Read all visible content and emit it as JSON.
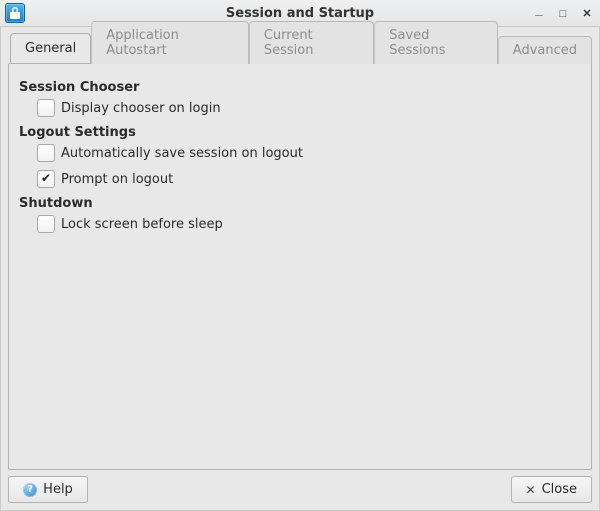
{
  "window": {
    "title": "Session and Startup"
  },
  "tabs": {
    "general": "General",
    "autostart": "Application Autostart",
    "current": "Current Session",
    "saved": "Saved Sessions",
    "advanced": "Advanced"
  },
  "sections": {
    "session_chooser": {
      "title": "Session Chooser",
      "display_chooser": {
        "label": "Display chooser on login",
        "checked": false
      }
    },
    "logout_settings": {
      "title": "Logout Settings",
      "auto_save": {
        "label": "Automatically save session on logout",
        "checked": false
      },
      "prompt": {
        "label": "Prompt on logout",
        "checked": true
      }
    },
    "shutdown": {
      "title": "Shutdown",
      "lock_screen": {
        "label": "Lock screen before sleep",
        "checked": false
      }
    }
  },
  "buttons": {
    "help": "Help",
    "close": "Close"
  }
}
